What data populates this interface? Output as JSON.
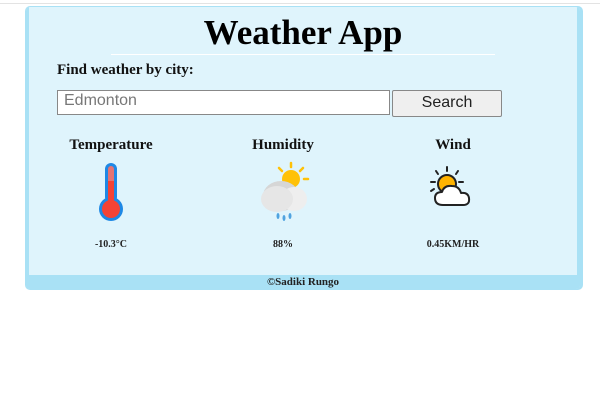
{
  "app": {
    "title": "Weather App"
  },
  "search": {
    "label": "Find weather by city:",
    "value": "Edmonton",
    "button_label": "Search"
  },
  "metrics": [
    {
      "label": "Temperature",
      "value": "-10.3°C",
      "icon": "thermometer-icon"
    },
    {
      "label": "Humidity",
      "value": "88%",
      "icon": "sun-cloud-rain-icon"
    },
    {
      "label": "Wind",
      "value": "0.45KM/HR",
      "icon": "partly-sunny-icon"
    }
  ],
  "footer": {
    "text": "©Sadiki Rungo"
  },
  "colors": {
    "card_bg": "#dff4fc",
    "border_accent": "#a9e1f5",
    "thermometer_blue": "#1e88e5",
    "thermometer_red": "#f44336",
    "sun_yellow": "#ffc107"
  }
}
